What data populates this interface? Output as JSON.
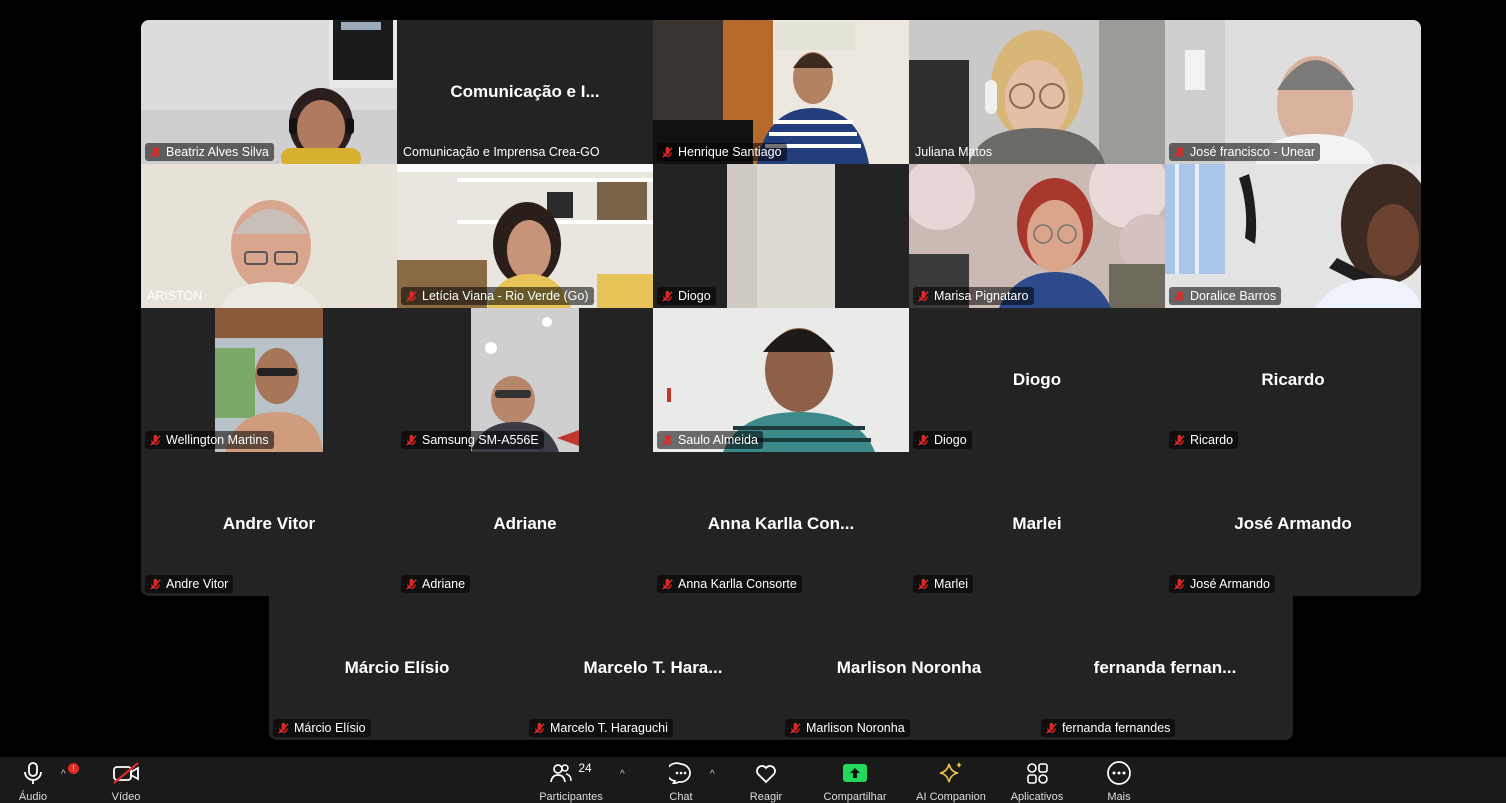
{
  "participants_grid": [
    {
      "display_name": "Beatriz Alves Silva",
      "tile_title": "",
      "video": true,
      "muted": true,
      "active_speaker": true
    },
    {
      "display_name": "Comunicação e Imprensa Crea-GO",
      "tile_title": "Comunicação e I...",
      "video": false,
      "muted": false
    },
    {
      "display_name": "Henrique Santiago",
      "tile_title": "",
      "video": true,
      "muted": true
    },
    {
      "display_name": "Juliana Matos",
      "tile_title": "",
      "video": true,
      "muted": false
    },
    {
      "display_name": "José francisco - Unear",
      "tile_title": "",
      "video": true,
      "muted": true
    },
    {
      "display_name": "ARISTON",
      "tile_title": "",
      "video": true,
      "muted": false
    },
    {
      "display_name": "Letícia Viana - Rio Verde (Go)",
      "tile_title": "",
      "video": true,
      "muted": true
    },
    {
      "display_name": "Diogo",
      "tile_title": "",
      "video": true,
      "muted": true
    },
    {
      "display_name": "Marisa Pignataro",
      "tile_title": "",
      "video": true,
      "muted": true
    },
    {
      "display_name": "Doralice Barros",
      "tile_title": "",
      "video": true,
      "muted": true
    },
    {
      "display_name": "Wellington Martins",
      "tile_title": "",
      "video": true,
      "muted": true
    },
    {
      "display_name": "Samsung SM-A556E",
      "tile_title": "",
      "video": true,
      "muted": true
    },
    {
      "display_name": "Saulo Almeida",
      "tile_title": "",
      "video": true,
      "muted": true
    },
    {
      "display_name": "Diogo",
      "tile_title": "Diogo",
      "video": false,
      "muted": true
    },
    {
      "display_name": "Ricardo",
      "tile_title": "Ricardo",
      "video": false,
      "muted": true
    },
    {
      "display_name": "Andre Vitor",
      "tile_title": "Andre Vitor",
      "video": false,
      "muted": true
    },
    {
      "display_name": "Adriane",
      "tile_title": "Adriane",
      "video": false,
      "muted": true
    },
    {
      "display_name": "Anna Karlla Consorte",
      "tile_title": "Anna  Karlla  Con...",
      "video": false,
      "muted": true
    },
    {
      "display_name": "Marlei",
      "tile_title": "Marlei",
      "video": false,
      "muted": true
    },
    {
      "display_name": "José Armando",
      "tile_title": "José Armando",
      "video": false,
      "muted": true
    }
  ],
  "participants_last_row": [
    {
      "display_name": "Márcio Elísio",
      "tile_title": "Márcio Elísio",
      "video": false,
      "muted": true
    },
    {
      "display_name": "Marcelo T. Haraguchi",
      "tile_title": "Marcelo T. Hara...",
      "video": false,
      "muted": true
    },
    {
      "display_name": "Marlison Noronha",
      "tile_title": "Marlison Noronha",
      "video": false,
      "muted": true
    },
    {
      "display_name": "fernanda fernandes",
      "tile_title": "fernanda  fernan...",
      "video": false,
      "muted": true
    }
  ],
  "toolbar": {
    "audio_label": "Áudio",
    "video_label": "Vídeo",
    "participants_label": "Participantes",
    "participants_count": "24",
    "chat_label": "Chat",
    "react_label": "Reagir",
    "share_label": "Compartilhar",
    "ai_label": "AI Companion",
    "apps_label": "Aplicativos",
    "more_label": "Mais",
    "audio_badge": "!"
  },
  "colors": {
    "tile_bg": "#232323",
    "active_speaker": "#23d959",
    "mute_red": "#e02828",
    "share_green": "#23d959",
    "ai_yellow": "#f2c14b"
  }
}
